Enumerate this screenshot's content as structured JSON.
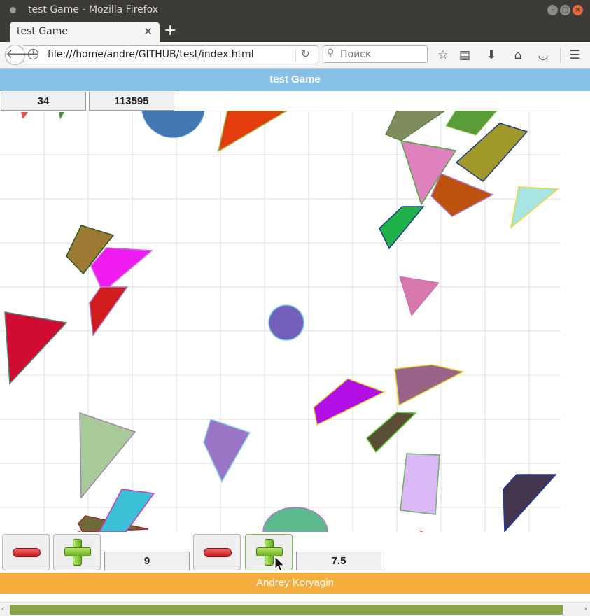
{
  "window": {
    "title": "test Game - Mozilla Firefox"
  },
  "tabs": [
    {
      "label": "test Game"
    }
  ],
  "nav": {
    "url": "file:///home/andre/GITHUB/test/index.html",
    "search_placeholder": "Поиск"
  },
  "page": {
    "header": "test Game",
    "scores": [
      "34",
      "113595"
    ],
    "value_a": "9",
    "value_b": "7.5",
    "footer": "Andrey Koryagin"
  },
  "colors": {
    "header_bg": "#87c0e6",
    "footer_bg": "#f4ac3d",
    "scrollbar_thumb": "#8aa24a"
  },
  "icons": [
    "back-icon",
    "info-icon",
    "reload-icon",
    "search-icon",
    "bookmark-star-icon",
    "reading-list-icon",
    "download-icon",
    "home-icon",
    "pocket-icon",
    "menu-icon",
    "minus-icon",
    "plus-icon",
    "mouse-cursor-icon"
  ]
}
